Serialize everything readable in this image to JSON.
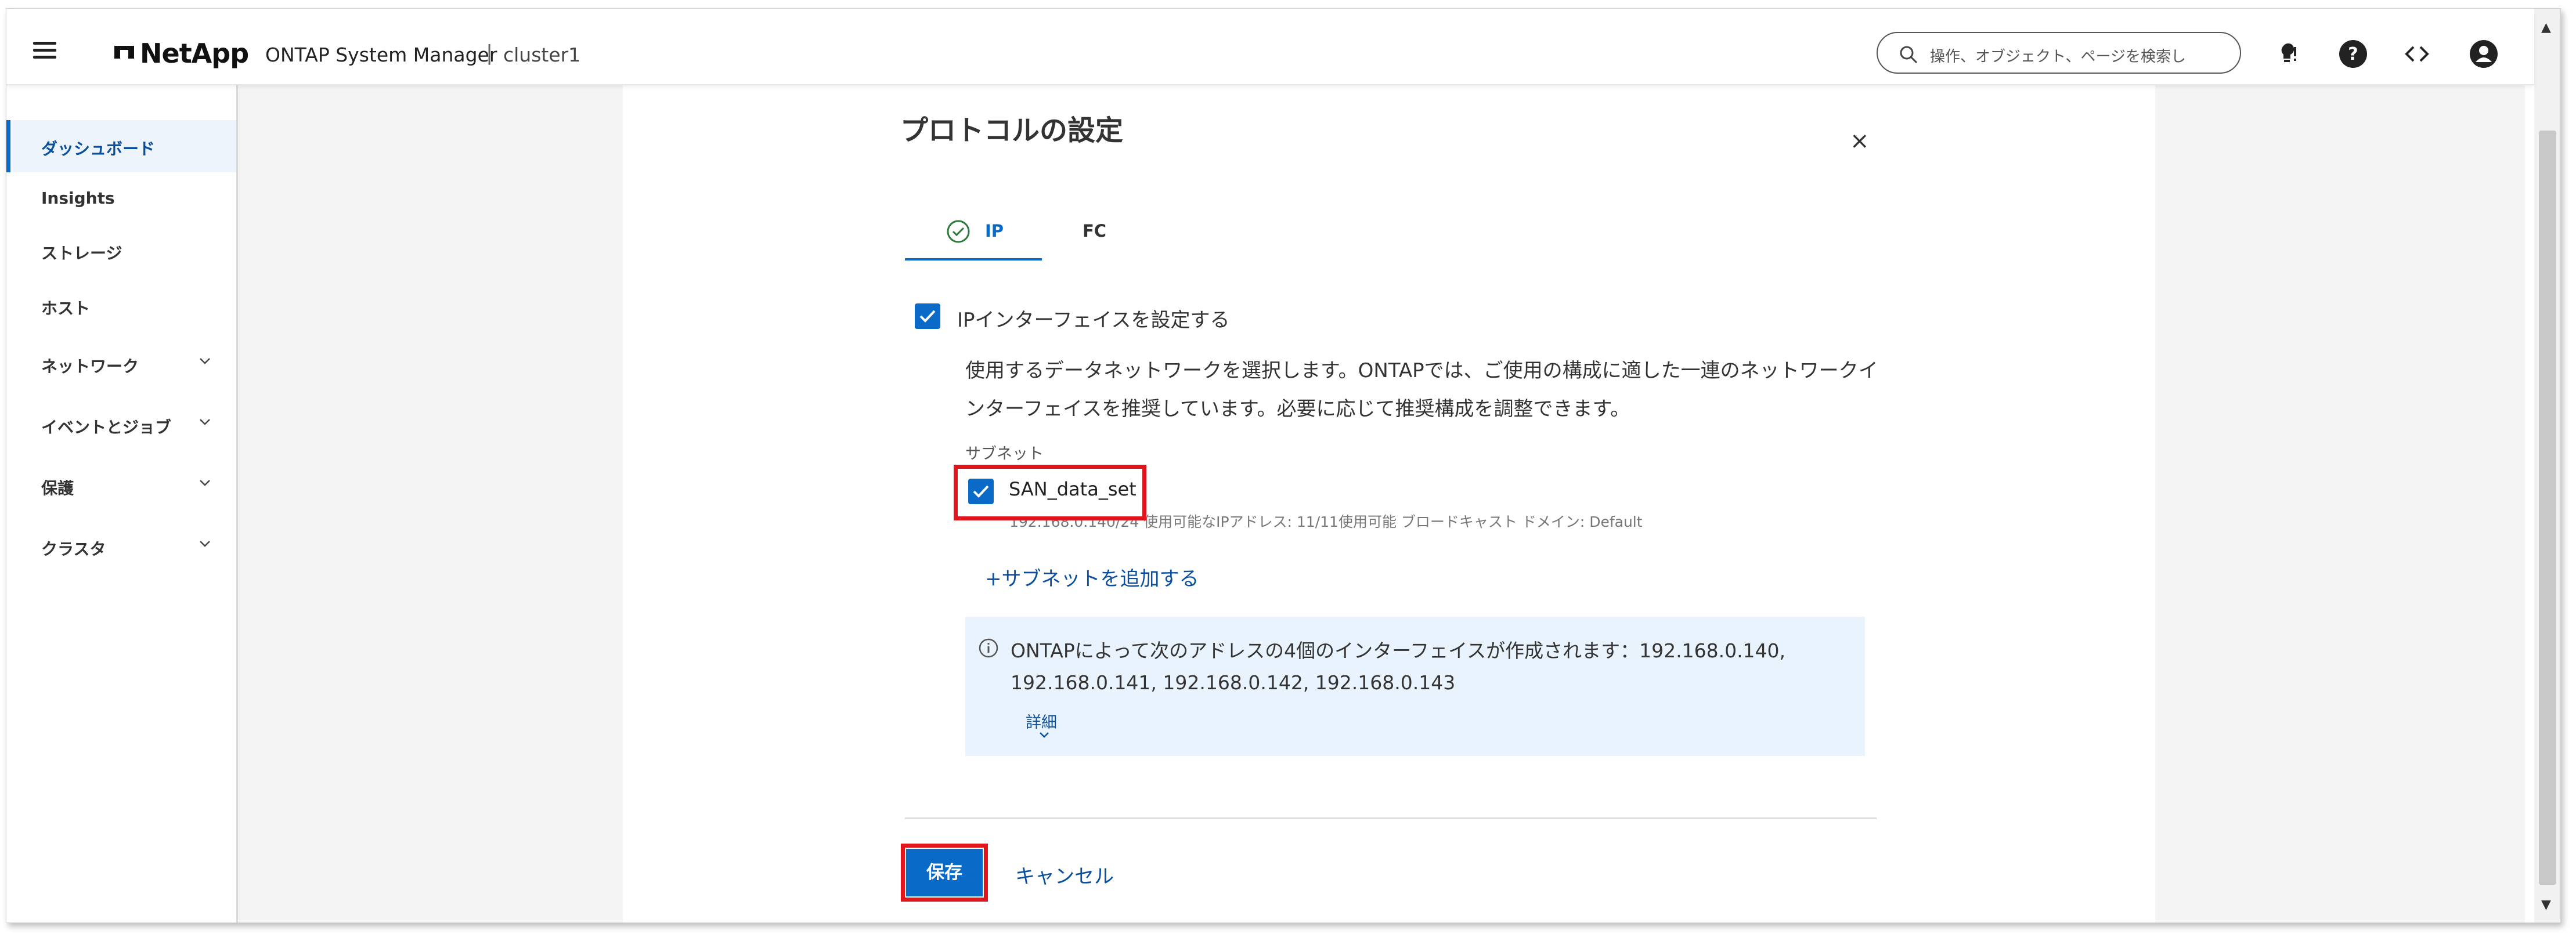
{
  "header": {
    "brand": "NetApp",
    "product": "ONTAP System Manager",
    "separator": "|",
    "cluster": "cluster1",
    "search_placeholder": "操作、オブジェクト、ページを検索し"
  },
  "sidebar": {
    "items": [
      {
        "label": "ダッシュボード",
        "active": true
      },
      {
        "label": "Insights"
      },
      {
        "label": "ストレージ"
      },
      {
        "label": "ホスト"
      },
      {
        "label": "ネットワーク",
        "expandable": true
      },
      {
        "label": "イベントとジョブ",
        "expandable": true
      },
      {
        "label": "保護",
        "expandable": true
      },
      {
        "label": "クラスタ",
        "expandable": true
      }
    ]
  },
  "dialog": {
    "title": "プロトコルの設定",
    "close": "×",
    "tabs": [
      {
        "label": "IP"
      },
      {
        "label": "FC"
      }
    ],
    "ip_checkbox_label": "IPインターフェイスを設定する",
    "description_line1": "使用するデータネットワークを選択します。ONTAPでは、ご使用の構成に適した一連のネットワークイ",
    "description_line2": "ンターフェイスを推奨しています。必要に応じて推奨構成を調整できます。",
    "subnet_header": "サブネット",
    "subnet_name": "SAN_data_set",
    "subnet_info": "192.168.0.140/24 使用可能なIPアドレス: 11/11使用可能 ブロードキャスト ドメイン: Default",
    "add_subnet": "+サブネットを追加する",
    "info_line1": "ONTAPによって次のアドレスの4個のインターフェイスが作成されます：192.168.0.140,",
    "info_line2": "192.168.0.141, 192.168.0.142, 192.168.0.143",
    "details": "詳細",
    "save": "保存",
    "cancel": "キャンセル"
  },
  "colors": {
    "accent": "#0a6ac7",
    "highlight": "#e0161c",
    "info_bg": "#e9f3fd"
  }
}
